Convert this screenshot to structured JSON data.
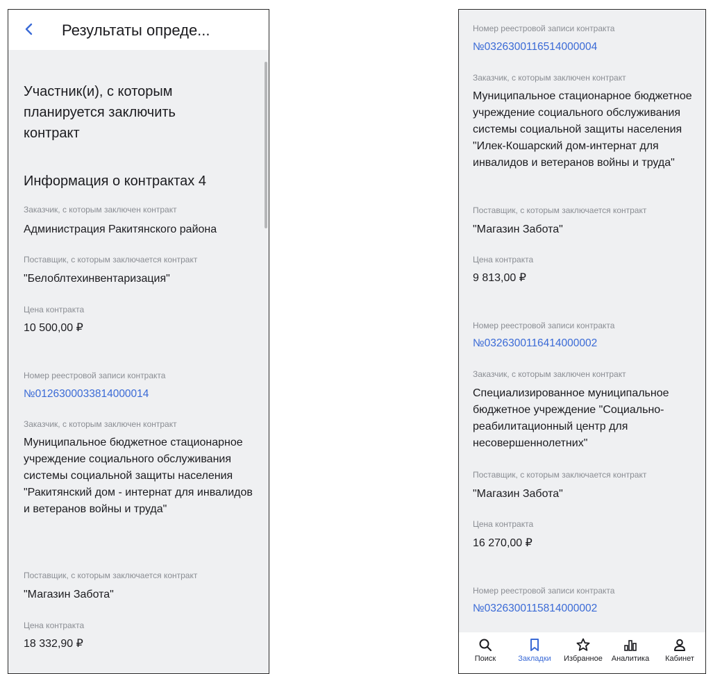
{
  "left": {
    "title": "Результаты опреде...",
    "section_participants": "Участник(и), с которым планируется заключить контракт",
    "section_contracts": "Информация о контрактах 4",
    "labels": {
      "customer": "Заказчик, с которым заключен контракт",
      "supplier": "Поставщик, с которым заключается  контракт",
      "price": "Цена контракта",
      "registry": "Номер реестровой записи контракта"
    },
    "contracts": [
      {
        "customer": "Администрация Ракитянского района",
        "supplier": "\"Белоблтехинвентаризация\"",
        "price": "10 500,00 ₽"
      },
      {
        "registry": "№0126300033814000014",
        "customer": "Муниципальное бюджетное стационарное учреждение социального обслуживания системы социальной защиты населения \"Ракитянский дом - интернат для инвалидов и ветеранов войны и труда\"",
        "supplier": "\"Магазин Забота\"",
        "price": "18 332,90 ₽"
      }
    ]
  },
  "right": {
    "labels": {
      "customer": "Заказчик, с которым заключен контракт",
      "supplier": "Поставщик, с которым заключается  контракт",
      "price": "Цена контракта",
      "registry": "Номер реестровой записи контракта"
    },
    "contracts": [
      {
        "registry": "№0326300116514000004",
        "customer": "Муниципальное стационарное бюджетное учреждение социального обслуживания системы социальной защиты населения \"Илек-Кошарский дом-интернат для инвалидов и ветеранов войны и труда\"",
        "supplier": "\"Магазин Забота\"",
        "price": "9 813,00 ₽"
      },
      {
        "registry": "№0326300116414000002",
        "customer": "Специализированное муниципальное бюджетное учреждение \"Социально-реабилитационный центр для несовершеннолетних\"",
        "supplier": "\"Магазин Забота\"",
        "price": "16 270,00 ₽"
      },
      {
        "registry": "№0326300115814000002"
      }
    ]
  },
  "nav": {
    "items": [
      {
        "label": "Поиск",
        "icon": "search-icon"
      },
      {
        "label": "Закладки",
        "icon": "bookmark-icon",
        "active": true
      },
      {
        "label": "Избранное",
        "icon": "star-icon"
      },
      {
        "label": "Аналитика",
        "icon": "analytics-icon"
      },
      {
        "label": "Кабинет",
        "icon": "user-icon"
      }
    ],
    "active_color": "#3a6ad6"
  },
  "colors": {
    "link": "#3a6ad6",
    "background": "#eff0f2",
    "label": "#8a8d93"
  }
}
